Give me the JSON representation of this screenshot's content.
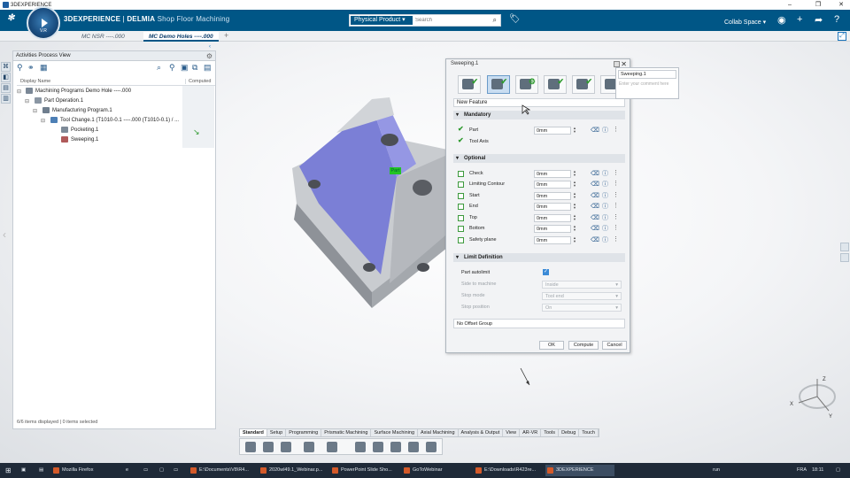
{
  "os_window": {
    "title": "3DEXPERIENCE",
    "controls": [
      "–",
      "❐",
      "✕"
    ]
  },
  "topbar": {
    "brand_3dx": "3DEXPERIENCE",
    "brand_sep": " | ",
    "brand_product": "DELMIA",
    "brand_app": "Shop Floor Machining",
    "compass_version": "V.R",
    "search_context": "Physical Product",
    "search_placeholder": "Search",
    "collab_space": "Collab Space"
  },
  "doc_tabs": [
    {
      "label": "MC NSR ----.000"
    },
    {
      "label": "MC Demo Holes ----.000"
    }
  ],
  "process_panel": {
    "title": "Activities Process View",
    "col_display_name": "Display Name",
    "col_computed": "Computed",
    "tree": [
      {
        "label": "Machining Programs Demo Hole ----.000"
      },
      {
        "label": "Part Operation.1"
      },
      {
        "label": "Manufacturing Program.1"
      },
      {
        "label": "Tool Change.1 (T1010-0.1 ----.000 (T1010-0.1) / ..."
      },
      {
        "label": "Pocketing.1"
      },
      {
        "label": "Sweeping.1"
      }
    ],
    "status": "6/6 items displayed | 0 items selected"
  },
  "model": {
    "part_label": "Part"
  },
  "dialog": {
    "title": "Sweeping.1",
    "new_feature": "New Feature",
    "mandatory": {
      "title": "Mandatory",
      "rows": [
        {
          "label": "Part",
          "value": "0mm"
        },
        {
          "label": "Tool Axis"
        }
      ]
    },
    "optional": {
      "title": "Optional",
      "rows": [
        {
          "label": "Check",
          "value": "0mm"
        },
        {
          "label": "Limiting Contour",
          "value": "0mm"
        },
        {
          "label": "Start",
          "value": "0mm"
        },
        {
          "label": "End",
          "value": "0mm"
        },
        {
          "label": "Top",
          "value": "0mm"
        },
        {
          "label": "Bottom",
          "value": "0mm"
        },
        {
          "label": "Safety plane",
          "value": "0mm"
        }
      ]
    },
    "limit_definition": {
      "title": "Limit Definition",
      "part_autolimit": "Part autolimit",
      "side_label": "Side to machine",
      "side_value": "Inside",
      "stop_mode_label": "Stop mode",
      "stop_mode_value": "Tool end",
      "stop_position_label": "Stop position",
      "stop_position_value": "On"
    },
    "offset_group": "No Offset Group",
    "ok": "OK",
    "compute": "Compute",
    "cancel": "Cancel"
  },
  "comment": {
    "name": "Sweeping.1",
    "placeholder": "Enter your comment here"
  },
  "action_bar": {
    "tabs": [
      "Standard",
      "Setup",
      "Programming",
      "Prismatic Machining",
      "Surface Machining",
      "Axial Machining",
      "Analysis & Output",
      "View",
      "AR-VR",
      "Tools",
      "Debug",
      "Touch"
    ],
    "active_tab": "Standard"
  },
  "taskbar": {
    "items": [
      "Mozilla Firefox",
      "E:\\Documents\\V8\\R4...",
      "2020wl49.1_Webinar.p...",
      "PowerPoint Slide Sho...",
      "GoToWebinar",
      "E:\\Downloads\\R423re...",
      "3DEXPERIENCE"
    ],
    "run": "run",
    "lang": "FRA",
    "time": "18:11"
  },
  "triad": {
    "x": "X",
    "y": "Y",
    "z": "Z"
  },
  "colors": {
    "topbar": "#005686",
    "part_face": "#7b7fd6",
    "check_green": "#2e9a2e"
  }
}
